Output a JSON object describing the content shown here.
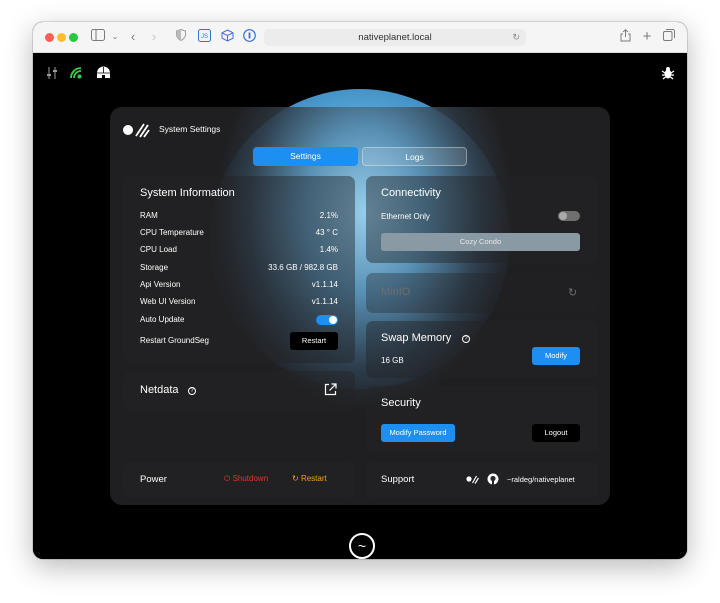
{
  "browser": {
    "url": "nativeplanet.local"
  },
  "panel": {
    "title": "System Settings",
    "tabs": [
      {
        "label": "Settings",
        "active": true
      },
      {
        "label": "Logs",
        "active": false
      }
    ]
  },
  "system_info": {
    "title": "System Information",
    "rows": [
      {
        "label": "RAM",
        "value": "2.1%"
      },
      {
        "label": "CPU Temperature",
        "value": "43 ° C"
      },
      {
        "label": "CPU Load",
        "value": "1.4%"
      },
      {
        "label": "Storage",
        "value": "33.6 GB / 982.8 GB"
      },
      {
        "label": "Api Version",
        "value": "v1.1.14"
      },
      {
        "label": "Web UI Version",
        "value": "v1.1.14"
      }
    ],
    "auto_update_label": "Auto Update",
    "auto_update_on": true,
    "restart_label": "Restart GroundSeg",
    "restart_button": "Restart"
  },
  "netdata": {
    "title": "Netdata",
    "help_glyph": "?",
    "external_icon": "external-link-icon"
  },
  "connectivity": {
    "title": "Connectivity",
    "ethernet_label": "Ethernet Only",
    "ethernet_on": false,
    "network_button": "Cozy Condo"
  },
  "minio": {
    "title": "MinIO",
    "refresh_icon": "refresh-icon"
  },
  "swap": {
    "title": "Swap Memory",
    "help_glyph": "?",
    "value": "16 GB",
    "modify_button": "Modify"
  },
  "security": {
    "title": "Security",
    "modify_password_button": "Modify Password",
    "logout_button": "Logout"
  },
  "power": {
    "title": "Power",
    "shutdown_label": "Shutdown",
    "restart_label": "Restart",
    "shutdown_color": "#e0362c",
    "restart_color": "#f0a020"
  },
  "support": {
    "title": "Support",
    "github_handle": "~raldeg/nativeplanet"
  },
  "colors": {
    "accent": "#1d8ef2",
    "background": "#000000",
    "status_green": "#2fd14a"
  }
}
